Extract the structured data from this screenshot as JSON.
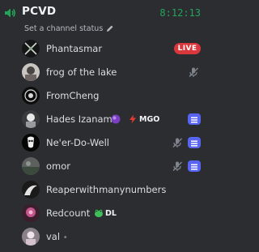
{
  "channel": {
    "name": "PCVD",
    "timer": "8:12:13",
    "status_placeholder": "Set a channel status",
    "icon": "speaker-icon"
  },
  "colors": {
    "background": "#2b2d31",
    "timer": "#23a559",
    "live": "#da373c",
    "activity": "#5865f2"
  },
  "members": [
    {
      "name": "Phantasmar",
      "badge": "LIVE"
    },
    {
      "name": "frog of the lake",
      "muted": true
    },
    {
      "name": "FromCheng"
    },
    {
      "name": "Hades Izanami",
      "tag": "MGO",
      "tag_icon": "lightning-icon",
      "activity": true
    },
    {
      "name": "Ne'er-Do-Well",
      "muted": true,
      "activity": true
    },
    {
      "name": "omor",
      "muted": true,
      "activity": true
    },
    {
      "name": "Reaperwithmanynumbers"
    },
    {
      "name": "Redcount",
      "tag": "DL",
      "tag_icon": "frog-icon"
    },
    {
      "name": "val",
      "suffix": "•"
    }
  ]
}
